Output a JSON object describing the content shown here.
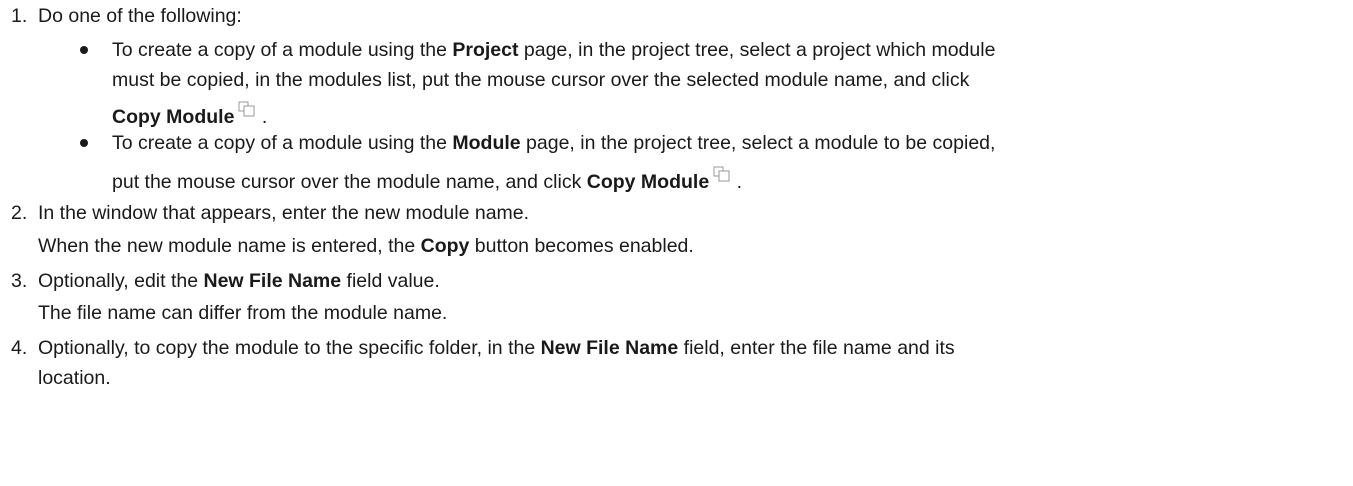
{
  "steps": [
    {
      "number": "1.",
      "text": "Do one of the following:",
      "bullets": [
        {
          "pre": "To create a copy of a module using the ",
          "bold1": "Project",
          "mid1": " page, in the project tree, select a project which module",
          "line2": "must be copied, in the modules list, put the mouse cursor over the selected module name, and click",
          "bold2": "Copy Module",
          "end": " ."
        },
        {
          "pre": "To create a copy of a module using the ",
          "bold1": "Module",
          "mid1": " page, in the project tree, select a module to be copied,",
          "line2": "put the mouse cursor over the module name, and click ",
          "bold2": "Copy Module",
          "end": " ."
        }
      ]
    },
    {
      "number": "2.",
      "text": "In the window that appears, enter the new module name.",
      "note_pre": "When the new module name is entered, the ",
      "note_bold": "Copy",
      "note_post": " button becomes enabled."
    },
    {
      "number": "3.",
      "text_pre": "Optionally, edit the ",
      "text_bold": "New File Name",
      "text_post": " field value.",
      "note": "The file name can differ from the module name."
    },
    {
      "number": "4.",
      "text_pre": "Optionally, to copy the module to the specific folder, in the ",
      "text_bold": "New File Name",
      "text_post": " field, enter the file name and its",
      "line2": "location."
    }
  ],
  "icons": {
    "copy": "copy-icon"
  }
}
